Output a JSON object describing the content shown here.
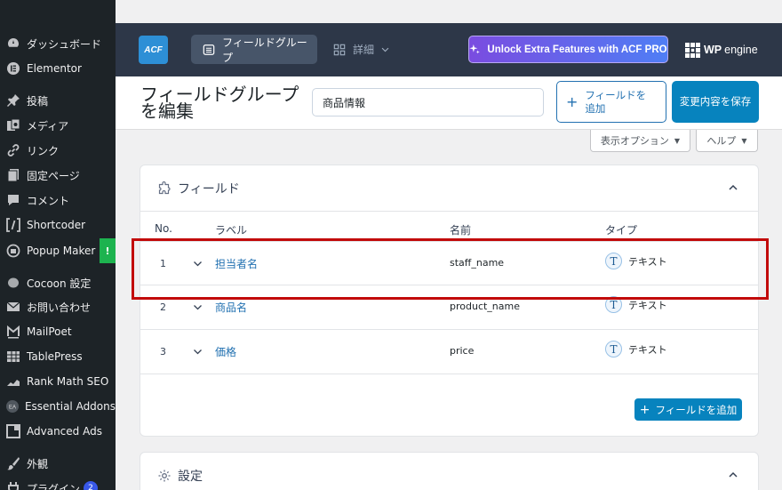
{
  "sidebar": {
    "items": [
      {
        "label": "ダッシュボード",
        "icon": "dashboard-icon"
      },
      {
        "label": "Elementor",
        "icon": "elementor-icon"
      },
      {
        "label": "投稿",
        "icon": "pin-icon"
      },
      {
        "label": "メディア",
        "icon": "media-icon"
      },
      {
        "label": "リンク",
        "icon": "link-icon"
      },
      {
        "label": "固定ページ",
        "icon": "page-icon"
      },
      {
        "label": "コメント",
        "icon": "comment-icon"
      },
      {
        "label": "Shortcoder",
        "icon": "shortcode-icon"
      },
      {
        "label": "Popup Maker",
        "icon": "popup-icon"
      },
      {
        "label": "Cocoon 設定",
        "icon": "cocoon-icon"
      },
      {
        "label": "お問い合わせ",
        "icon": "mail-icon"
      },
      {
        "label": "MailPoet",
        "icon": "mailpoet-icon"
      },
      {
        "label": "TablePress",
        "icon": "table-icon"
      },
      {
        "label": "Rank Math SEO",
        "icon": "chart-icon"
      },
      {
        "label": "Essential Addons",
        "icon": "ea-icon"
      },
      {
        "label": "Advanced Ads",
        "icon": "ads-icon"
      },
      {
        "label": "外観",
        "icon": "brush-icon"
      },
      {
        "label": "プラグイン",
        "icon": "plugin-icon"
      }
    ],
    "popup_badge": "!",
    "plugin_count": "2"
  },
  "header": {
    "logo": "ACF",
    "nav_active": "フィールドグループ",
    "nav_detail": "詳細",
    "pro_button": "Unlock Extra Features with ACF PRO",
    "wp_engine_bold": "WP",
    "wp_engine_rest": "engine"
  },
  "titlebar": {
    "title": "フィールドグループを編集",
    "input_value": "商品情報",
    "add_field_label": "フィールドを追加",
    "save_label": "変更内容を保存"
  },
  "screen_options": {
    "display": "表示オプション",
    "help": "ヘルプ"
  },
  "fields_panel": {
    "title": "フィールド",
    "columns": {
      "no": "No.",
      "label": "ラベル",
      "name": "名前",
      "type": "タイプ"
    },
    "rows": [
      {
        "num": "1",
        "label": "担当者名",
        "name": "staff_name",
        "type": "テキスト",
        "type_icon": "T"
      },
      {
        "num": "2",
        "label": "商品名",
        "name": "product_name",
        "type": "テキスト",
        "type_icon": "T"
      },
      {
        "num": "3",
        "label": "価格",
        "name": "price",
        "type": "テキスト",
        "type_icon": "T"
      }
    ],
    "add_button": "フィールドを追加"
  },
  "settings_panel": {
    "title": "設定"
  },
  "colors": {
    "sidebar_bg": "#1d2327",
    "header_bg": "#2d3748",
    "primary": "#0783be",
    "link": "#2271b1",
    "highlight": "#c20b0b"
  }
}
